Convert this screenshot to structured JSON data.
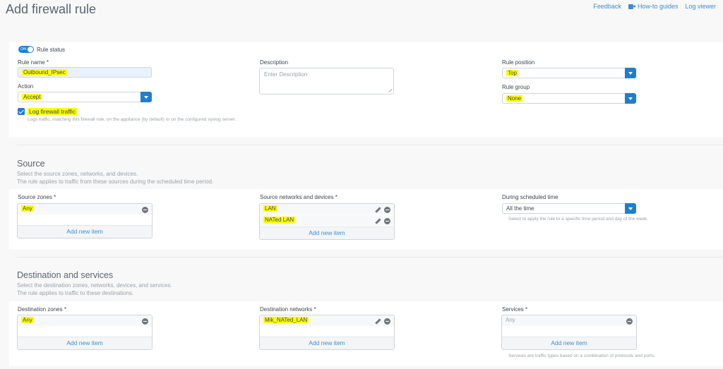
{
  "header": {
    "title": "Add firewall rule",
    "links": {
      "feedback": "Feedback",
      "howto": "How-to guides",
      "logviewer": "Log viewer"
    }
  },
  "general": {
    "rule_status_label": "Rule status",
    "rule_status_toggle": "ON",
    "rule_name_label": "Rule name *",
    "rule_name_value": "Outbound_IPsec",
    "action_label": "Action",
    "action_value": "Accept",
    "log_label": "Log firewall traffic",
    "log_checked": true,
    "log_help": "Logs traffic, matching this firewall rule, on the appliance (by default) or on the configured syslog server.",
    "description_label": "Description",
    "description_placeholder": "Enter Description",
    "rule_position_label": "Rule position",
    "rule_position_value": "Top",
    "rule_group_label": "Rule group",
    "rule_group_value": "None"
  },
  "source": {
    "title": "Source",
    "desc1": "Select the source zones, networks, and devices.",
    "desc2": "The rule applies to traffic from these sources during the scheduled time period.",
    "zones_label": "Source zones *",
    "zones": [
      "Any"
    ],
    "networks_label": "Source networks and devices *",
    "networks": [
      "LAN",
      "NATed LAN"
    ],
    "schedule_label": "During scheduled time",
    "schedule_value": "All the time",
    "schedule_help": "Select to apply the rule to a specific time period and day of the week.",
    "add_new": "Add new item"
  },
  "destination": {
    "title": "Destination and services",
    "desc1": "Select the destination zones, networks, devices, and services.",
    "desc2": "The rule applies to traffic to these destinations.",
    "zones_label": "Destination zones *",
    "zones": [
      "Any"
    ],
    "networks_label": "Destination networks *",
    "networks": [
      "Mik_NATed_LAN"
    ],
    "services_label": "Services *",
    "services": [
      "Any"
    ],
    "services_help": "Services are traffic types based on a combination of protocols and ports.",
    "add_new": "Add new item"
  },
  "colors": {
    "accent": "#1f7ed0",
    "link": "#3a8dd6",
    "highlight": "#ffff00"
  }
}
